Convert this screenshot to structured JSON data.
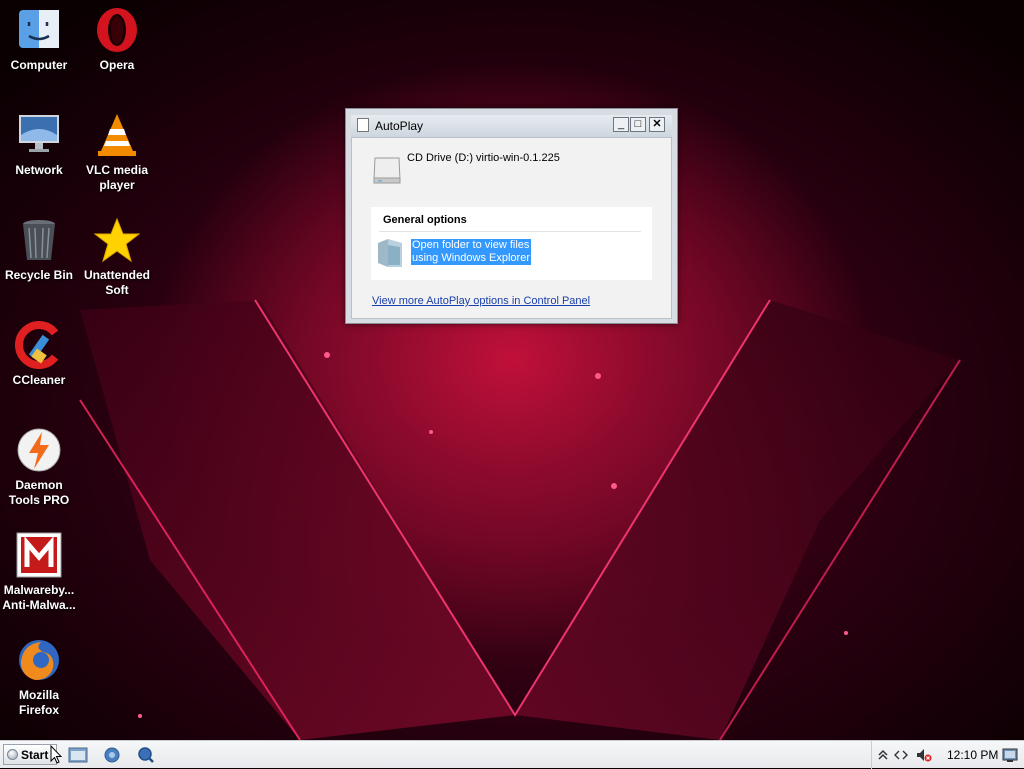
{
  "desktop": {
    "icons": [
      {
        "label": "Computer",
        "icon": "finder-computer-icon"
      },
      {
        "label": "Opera",
        "icon": "opera-icon"
      },
      {
        "label": "Network",
        "icon": "monitor-network-icon"
      },
      {
        "label": "VLC media player",
        "icon": "vlc-cone-icon"
      },
      {
        "label": "Recycle Bin",
        "icon": "trash-bin-icon"
      },
      {
        "label": "Unattended Soft",
        "icon": "star-icon"
      },
      {
        "label": "CCleaner",
        "icon": "ccleaner-icon"
      },
      {
        "label": "Daemon Tools PRO",
        "icon": "daemon-tools-icon"
      },
      {
        "label": "Malwareby... Anti-Malwa...",
        "icon": "malwarebytes-icon"
      },
      {
        "label": "Mozilla Firefox",
        "icon": "firefox-icon"
      }
    ]
  },
  "autoplay": {
    "title": "AutoPlay",
    "drive_label": "CD Drive (D:) virtio-win-0.1.225",
    "group_header": "General options",
    "option_label": "Open folder to view files using Windows Explorer",
    "link": "View more AutoPlay options in Control Panel",
    "buttons": {
      "minimize": "_",
      "maximize": "□",
      "close": "✕"
    }
  },
  "taskbar": {
    "start_label": "Start",
    "quick_launch": [
      "file-explorer-icon",
      "browser-globe-icon",
      "search-globe-icon"
    ],
    "tray_icons": [
      "show-hidden-icons-chevron",
      "network-arrows-icon",
      "volume-muted-icon"
    ],
    "clock": "12:10 PM"
  },
  "colors": {
    "accent_red": "#c0103a",
    "selection_blue": "#3399ff",
    "link_blue": "#1a3fa8"
  }
}
